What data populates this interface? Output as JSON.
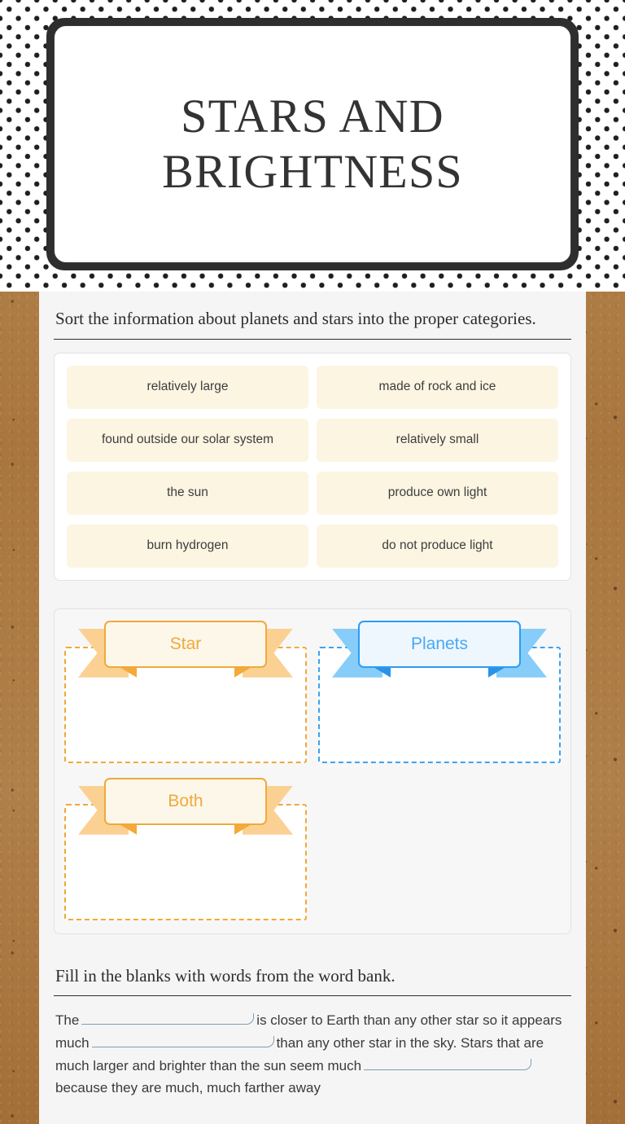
{
  "header": {
    "title": "STARS AND BRIGHTNESS",
    "pattern": "polka-dot",
    "frame_color": "#2e2e2e",
    "title_color": "#333333"
  },
  "colors": {
    "page_background": "#a9773f",
    "sheet_background": "#f5f5f5",
    "word_tile": "#fcf5e2",
    "star_accent": "#f0a93a",
    "planets_accent": "#2d9cf5",
    "blank_underline": "#7d9fb3"
  },
  "sort_section": {
    "instructions": "Sort the information about planets and stars into the proper categories.",
    "word_bank": [
      {
        "label": "relatively large"
      },
      {
        "label": "made of rock and ice"
      },
      {
        "label": "found outside our solar system"
      },
      {
        "label": "relatively small"
      },
      {
        "label": "the sun"
      },
      {
        "label": "produce own light"
      },
      {
        "label": "burn hydrogen"
      },
      {
        "label": "do not produce light"
      }
    ],
    "categories": [
      {
        "label": "Star",
        "accent": "#f0a93a",
        "theme": "orange",
        "items": []
      },
      {
        "label": "Planets",
        "accent": "#2d9cf5",
        "theme": "blue",
        "items": []
      },
      {
        "label": "Both",
        "accent": "#f0a93a",
        "theme": "orange",
        "items": []
      }
    ]
  },
  "fill_section": {
    "instructions": "Fill in the blanks with words from the word bank.",
    "text_parts": {
      "p1": "The",
      "p2": "is closer to Earth than any other star so it appears much",
      "p3": "than any other star in the sky. Stars that are much larger and brighter than the sun seem much",
      "p4": "because they are much, much farther away"
    }
  }
}
